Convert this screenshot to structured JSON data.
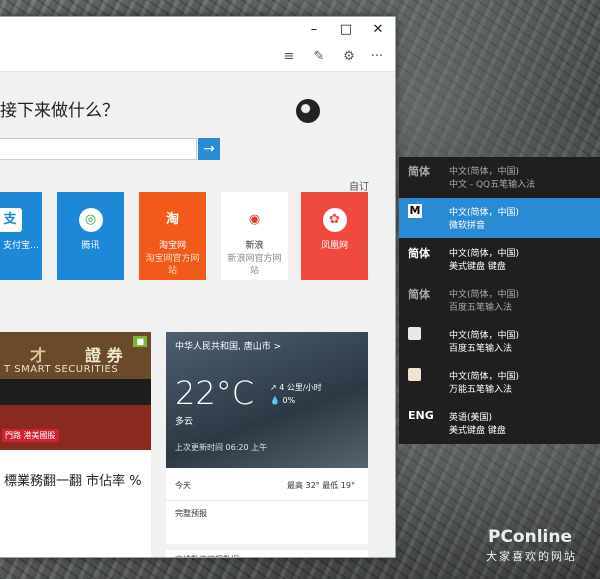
{
  "colors": {
    "accent": "#2a8ad4",
    "ime_bg": "#1f1f1f",
    "tile_blue": "#1e88d8",
    "tile_orange": "#f25a1c",
    "tile_red": "#f04a3e"
  },
  "window": {
    "controls": {
      "minimize": "–",
      "maximize": "□",
      "close": "✕"
    },
    "toolbar_icons": [
      "hub-icon",
      "note-icon",
      "share-icon",
      "more-icon"
    ]
  },
  "newtab": {
    "question": "接下来做什么？",
    "search_placeholder": "",
    "pin_label": "自订",
    "tiles": [
      {
        "label": "支付宝…",
        "sub": "",
        "icon": "alipay-icon"
      },
      {
        "label": "腾讯",
        "sub": "",
        "icon": "qq-icon"
      },
      {
        "label": "淘宝网",
        "sub": "淘宝网官方网站",
        "icon": "taobao-icon"
      },
      {
        "label": "新浪",
        "sub": "新浪网官方网站",
        "icon": "weibo-icon"
      },
      {
        "label": "凤凰网",
        "sub": "",
        "icon": "ifeng-icon"
      }
    ]
  },
  "news": {
    "photo_sign_1": "才",
    "photo_sign_2": "證 券",
    "photo_sign_en": "T SMART SECURITIES",
    "photo_badge": "",
    "photo_caption": "門路 港美國股",
    "headline": "標業務翻一翻 市佔率 %"
  },
  "weather": {
    "location": "中华人民共和国, 唐山市 >",
    "temperature": "22°C",
    "condition": "多云",
    "wind": "4 公里/小时",
    "rain": "0%",
    "updated": "上次更新时间 06:20 上午",
    "today_label": "今天",
    "today_detail": "最高 32° 最低 19°",
    "full_forecast": "完整预报",
    "more_label": "高维数值可视数据 >"
  },
  "ime": {
    "items": [
      {
        "icon": "简体",
        "line1": "中文(简体，中国)",
        "line2": "中文 - QQ五笔输入法",
        "selected": false,
        "dim": true
      },
      {
        "icon": "M",
        "line1": "中文(简体，中国)",
        "line2": "微软拼音",
        "selected": true,
        "dim": false
      },
      {
        "icon": "简体",
        "line1": "中文(简体，中国)",
        "line2": "美式键盘 键盘",
        "selected": false,
        "dim": false
      },
      {
        "icon": "简体",
        "line1": "中文(简体，中国)",
        "line2": "百度五笔输入法",
        "selected": false,
        "dim": true
      },
      {
        "icon": "",
        "line1": "中文(简体，中国)",
        "line2": "百度五笔输入法",
        "selected": false,
        "dim": false
      },
      {
        "icon": "",
        "line1": "中文(简体，中国)",
        "line2": "万能五笔输入法",
        "selected": false,
        "dim": false
      },
      {
        "icon": "ENG",
        "line1": "英语(美国)",
        "line2": "美式键盘 键盘",
        "selected": false,
        "dim": false
      }
    ]
  },
  "watermark": {
    "brand": "PConline",
    "sub": "大家喜欢的网站"
  }
}
